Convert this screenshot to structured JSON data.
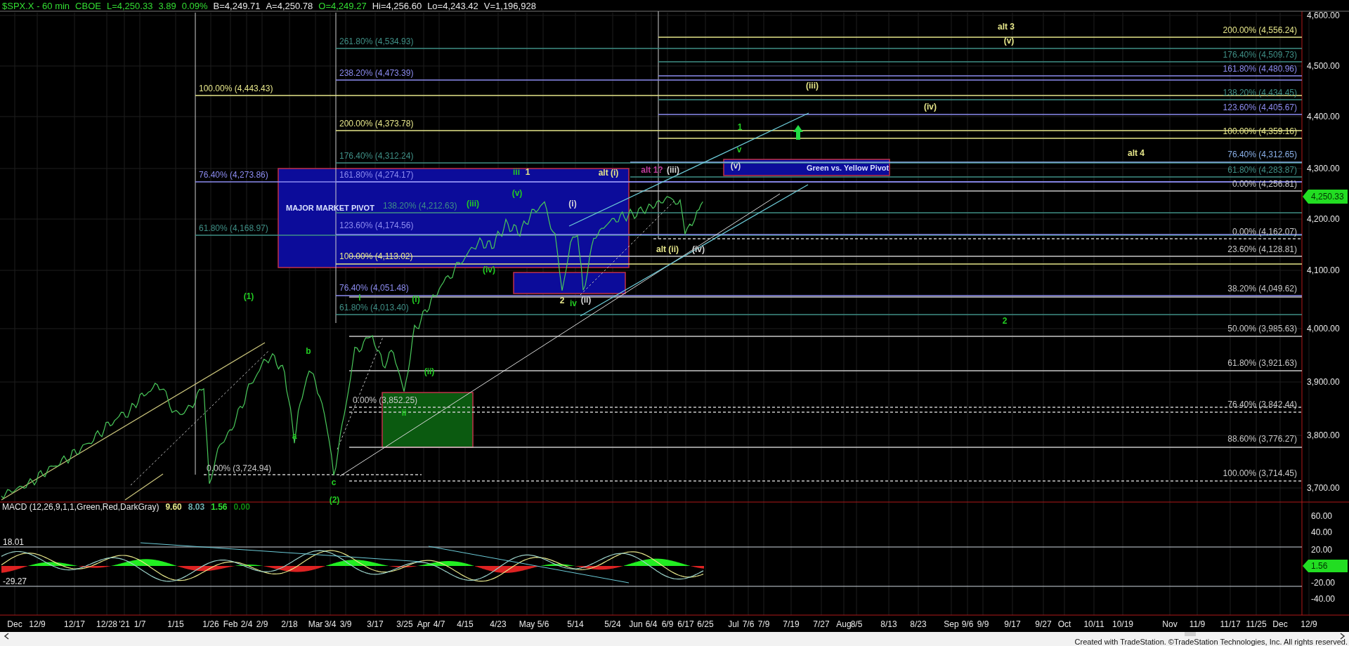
{
  "header": [
    {
      "text": "$SPX.X - 60 min",
      "color": "#33dd33"
    },
    {
      "text": "CBOE",
      "color": "#33dd33"
    },
    {
      "text": "L=4,250.33",
      "color": "#33dd33"
    },
    {
      "text": "3.89",
      "color": "#33dd33"
    },
    {
      "text": "0.09%",
      "color": "#33dd33"
    },
    {
      "text": "B=4,249.71",
      "color": "#e8e8e8"
    },
    {
      "text": "A=4,250.78",
      "color": "#e8e8e8"
    },
    {
      "text": "O=4,249.27",
      "color": "#33dd33"
    },
    {
      "text": "Hi=4,256.60",
      "color": "#e8e8e8"
    },
    {
      "text": "Lo=4,243.42",
      "color": "#e8e8e8"
    },
    {
      "text": "V=1,196,928",
      "color": "#e8e8e8"
    }
  ],
  "zones": [
    {
      "label": "MAJOR MARKET PIVOT",
      "color": "#0c0c9a"
    },
    {
      "color": "#0c0c9a"
    },
    {
      "color": "#0b5a10"
    },
    {
      "label": "Green vs. Yellow Pivot",
      "color": "#0c0c9a"
    }
  ],
  "fib_levels": [
    {
      "label": "261.80% (4,534.93)",
      "color": "#3f8f86"
    },
    {
      "label": "238.20% (4,473.39)",
      "color": "#8c8cf0"
    },
    {
      "label": "100.00% (4,443.43)",
      "color": "#e6e68a"
    },
    {
      "label": "200.00% (4,373.78)",
      "color": "#e6e68a"
    },
    {
      "label": "176.40% (4,312.24)",
      "color": "#3f8f86"
    },
    {
      "label": "76.40% (4,273.86)",
      "color": "#8c8cf0"
    },
    {
      "label": "161.80% (4,274.17)",
      "color": "#8c8cf0"
    },
    {
      "label": "138.20% (4,212.63)",
      "color": "#3f8f86"
    },
    {
      "label": "61.80% (4,168.97)",
      "color": "#3f8f86"
    },
    {
      "label": "123.60% (4,174.56)",
      "color": "#8c8cf0"
    },
    {
      "label": "100.00% (4,113.02)",
      "color": "#e6e68a"
    },
    {
      "label": "76.40% (4,051.48)",
      "color": "#8c8cf0"
    },
    {
      "label": "61.80% (4,013.40)",
      "color": "#3f8f86"
    },
    {
      "label": "0.00% (3,852.25)",
      "color": "#c8c8c8"
    },
    {
      "label": "0.00% (3,724.94)",
      "color": "#c8c8c8"
    },
    {
      "label": "200.00% (4,556.24)",
      "color": "#e6e68a"
    },
    {
      "label": "176.40% (4,509.73)",
      "color": "#3f8f86"
    },
    {
      "label": "161.80% (4,480.96)",
      "color": "#8c8cf0"
    },
    {
      "label": "138.20% (4,434.45)",
      "color": "#3f8f86"
    },
    {
      "label": "123.60% (4,405.67)",
      "color": "#8c8cf0"
    },
    {
      "label": "100.00% (4,359.16)",
      "color": "#e6e68a"
    },
    {
      "label": "76.40% (4,312.65)",
      "color": "#8ab0e8"
    },
    {
      "label": "61.80% (4,283.87)",
      "color": "#3f8f86"
    },
    {
      "label": "0.00% (4,256.81)",
      "color": "#c8c8c8"
    },
    {
      "label": "0.00% (4,162.07)",
      "color": "#c8c8c8"
    },
    {
      "label": "23.60% (4,128.81)",
      "color": "#c8c8c8"
    },
    {
      "label": "38.20% (4,049.62)",
      "color": "#c8c8c8"
    },
    {
      "label": "50.00% (3,985.63)",
      "color": "#c8c8c8"
    },
    {
      "label": "61.80% (3,921.63)",
      "color": "#c8c8c8"
    },
    {
      "label": "76.40% (3,842.44)",
      "color": "#c8c8c8"
    },
    {
      "label": "88.60% (3,776.27)",
      "color": "#c8c8c8"
    },
    {
      "label": "100.00% (3,714.45)",
      "color": "#c8c8c8"
    }
  ],
  "wave_labels": [
    {
      "label": "alt 3",
      "color": "#e6e68a"
    },
    {
      "label": "(v)",
      "color": "#e6e68a"
    },
    {
      "label": "(iii)",
      "color": "#e6e68a"
    },
    {
      "label": "(iv)",
      "color": "#e6e68a"
    },
    {
      "label": "1",
      "color": "#22cc22"
    },
    {
      "label": "v",
      "color": "#22cc22"
    },
    {
      "label": "alt 4",
      "color": "#e6e68a"
    },
    {
      "label": "(v)",
      "color": "#d8d8d8"
    },
    {
      "label": "iii",
      "color": "#22cc22"
    },
    {
      "label": "1",
      "color": "#e6e68a"
    },
    {
      "label": "alt (i)",
      "color": "#e6e68a"
    },
    {
      "label": "alt 1?",
      "color": "#c03c9c"
    },
    {
      "label": "(iii)",
      "color": "#d8d8d8"
    },
    {
      "label": "(v)",
      "color": "#22cc22"
    },
    {
      "label": "(iii)",
      "color": "#22cc22"
    },
    {
      "label": "(i)",
      "color": "#d8d8d8"
    },
    {
      "label": "alt (ii)",
      "color": "#e6e68a"
    },
    {
      "label": "(iv)",
      "color": "#d8d8d8"
    },
    {
      "label": "(iv)",
      "color": "#22cc22"
    },
    {
      "label": "(1)",
      "color": "#22cc22"
    },
    {
      "label": "i",
      "color": "#22cc22"
    },
    {
      "label": "(i)",
      "color": "#22cc22"
    },
    {
      "label": "2",
      "color": "#e6e68a"
    },
    {
      "label": "iv",
      "color": "#22cc22"
    },
    {
      "label": "(ii)",
      "color": "#d8d8d8"
    },
    {
      "label": "2",
      "color": "#22cc22"
    },
    {
      "label": "b",
      "color": "#22cc22"
    },
    {
      "label": "(ii)",
      "color": "#22cc22"
    },
    {
      "label": "ii",
      "color": "#22cc22"
    },
    {
      "label": "a",
      "color": "#22cc22"
    },
    {
      "label": "c",
      "color": "#22cc22"
    },
    {
      "label": "(2)",
      "color": "#22cc22"
    }
  ],
  "price_axis": [
    "4,600.00",
    "4,500.00",
    "4,400.00",
    "4,300.00",
    "4,200.00",
    "4,100.00",
    "4,000.00",
    "3,900.00",
    "3,800.00",
    "3,700.00"
  ],
  "last_price_tag": "4,250.33",
  "macd": {
    "title": "MACD (12,26,9,1,1,Green,Red,DarkGray)",
    "readings": [
      {
        "text": "9.60",
        "color": "#e6e68a"
      },
      {
        "text": "8.03",
        "color": "#6fb0b0"
      },
      {
        "text": "1.56",
        "color": "#33dd33"
      },
      {
        "text": "0.00",
        "color": "#118811"
      }
    ],
    "levels": [
      "18.01",
      "-29.27"
    ],
    "axis": [
      "60.00",
      "40.00",
      "20.00",
      "-20.00",
      "-40.00"
    ],
    "value_tag": "1.56"
  },
  "time_axis": [
    "Dec",
    "12/9",
    "12/17",
    "12/28",
    "'21",
    "1/7",
    "1/15",
    "1/26",
    "Feb",
    "2/4",
    "2/9",
    "2/18",
    "Mar",
    "3/4",
    "3/9",
    "3/17",
    "3/25",
    "Apr",
    "4/7",
    "4/15",
    "4/23",
    "May",
    "5/6",
    "5/14",
    "5/24",
    "Jun",
    "6/4",
    "6/9",
    "6/17",
    "6/25",
    "Jul",
    "7/6",
    "7/9",
    "7/19",
    "7/27",
    "Aug",
    "8/5",
    "8/13",
    "8/23",
    "Sep",
    "9/6",
    "9/9",
    "9/17",
    "9/27",
    "Oct",
    "10/11",
    "10/19",
    "Nov",
    "11/9",
    "11/17",
    "11/25",
    "Dec",
    "12/9"
  ],
  "credit": "Created with TradeStation. ©TradeStation Technologies, Inc. All rights reserved."
}
